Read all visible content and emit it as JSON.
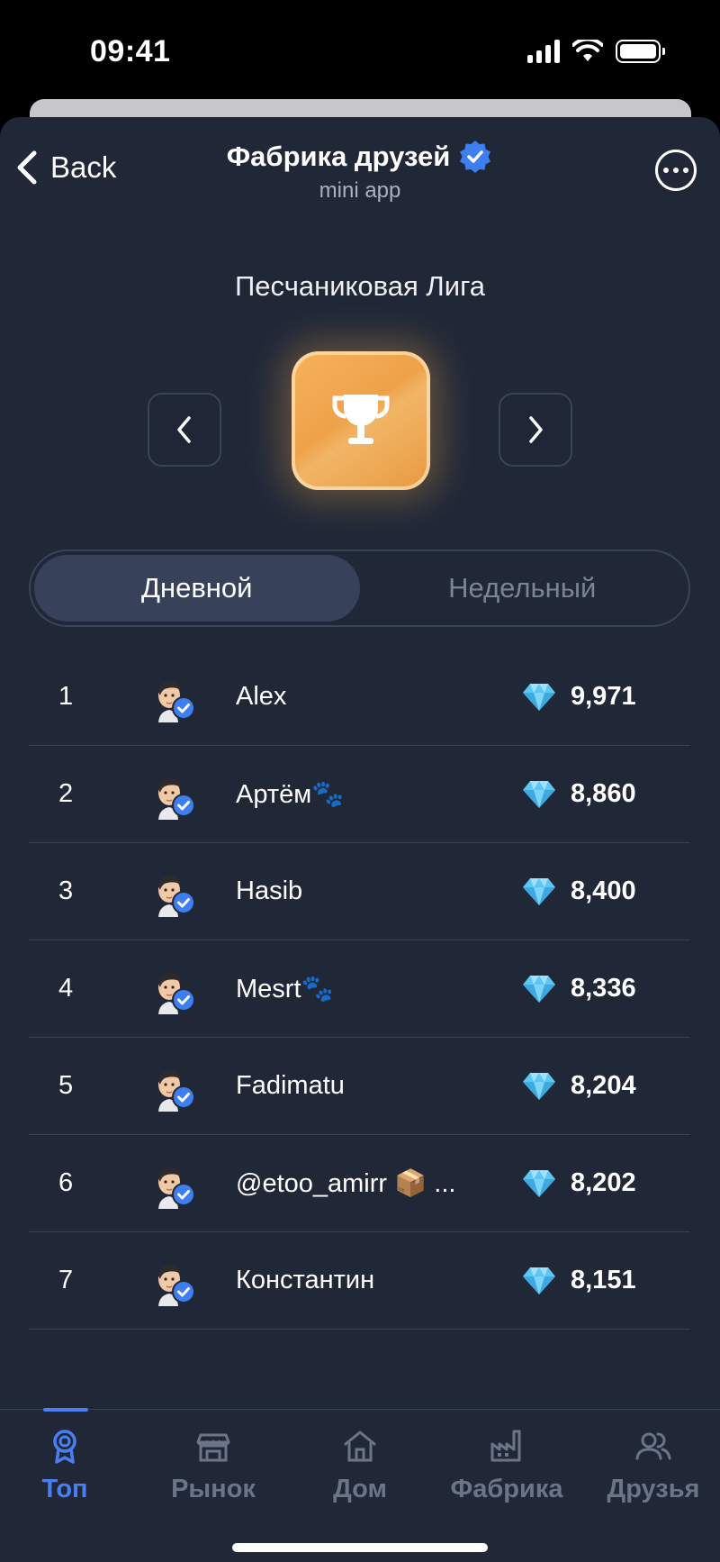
{
  "status_bar": {
    "time": "09:41"
  },
  "header": {
    "back_label": "Back",
    "title": "Фабрика друзей",
    "subtitle": "mini app"
  },
  "league": {
    "title": "Песчаниковая Лига"
  },
  "tabs": {
    "daily": "Дневной",
    "weekly": "Недельный"
  },
  "leaderboard": [
    {
      "rank": "1",
      "name": "Alex",
      "score": "9,971"
    },
    {
      "rank": "2",
      "name": "Артём🐾",
      "score": "8,860"
    },
    {
      "rank": "3",
      "name": "Hasib",
      "score": "8,400"
    },
    {
      "rank": "4",
      "name": "Mesrt🐾",
      "score": "8,336"
    },
    {
      "rank": "5",
      "name": "Fadimatu",
      "score": "8,204"
    },
    {
      "rank": "6",
      "name": "@etoo_amirr 📦 ...",
      "score": "8,202"
    },
    {
      "rank": "7",
      "name": "Константин",
      "score": "8,151"
    }
  ],
  "bottom_nav": [
    {
      "label": "Топ",
      "icon": "trophy-ribbon-icon"
    },
    {
      "label": "Рынок",
      "icon": "store-icon"
    },
    {
      "label": "Дом",
      "icon": "home-icon"
    },
    {
      "label": "Фабрика",
      "icon": "factory-icon"
    },
    {
      "label": "Друзья",
      "icon": "users-icon"
    }
  ],
  "colors": {
    "background": "#202838",
    "accent": "#4b7df3",
    "trophy": "#eea24a"
  }
}
